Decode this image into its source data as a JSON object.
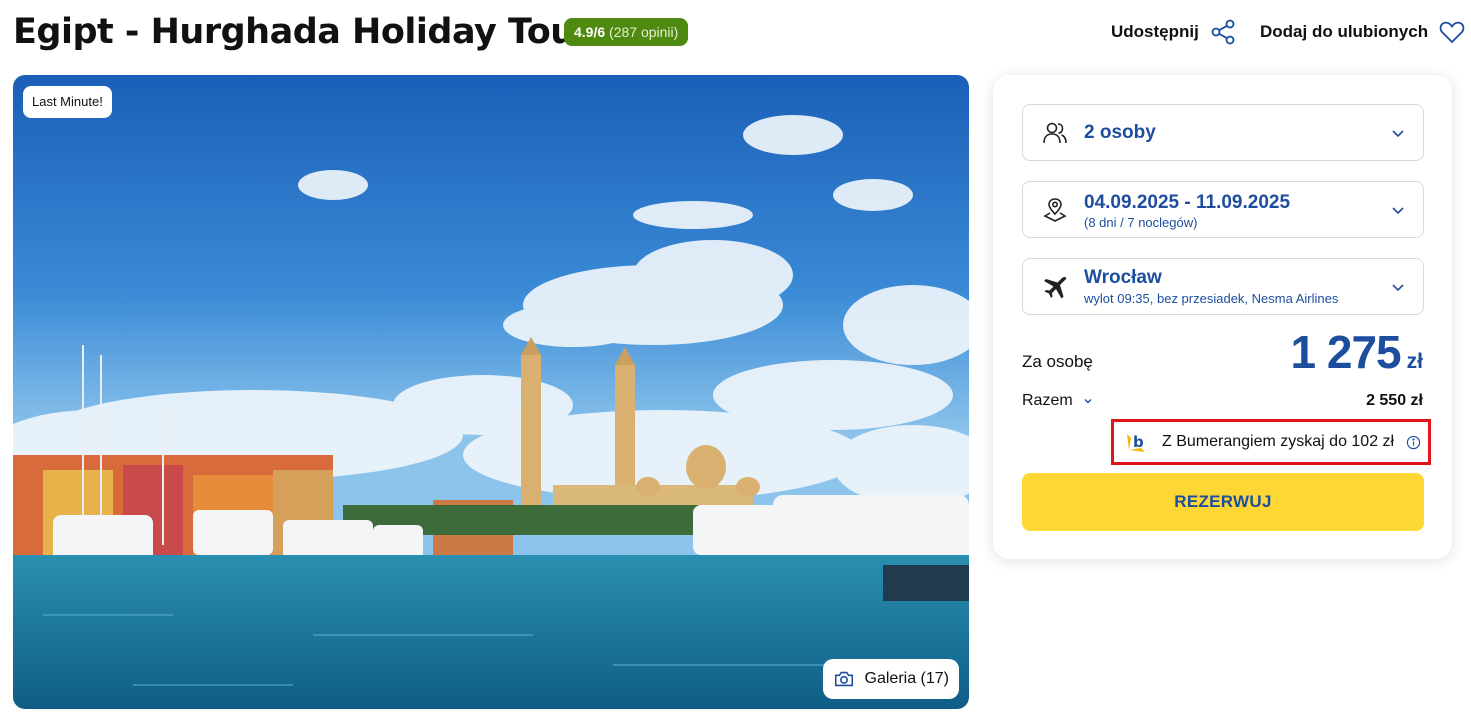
{
  "header": {
    "title": "Egipt - Hurghada Holiday Tour",
    "rating_score": "4.9/6",
    "rating_count": "(287 opinii)",
    "share_label": "Udostępnij",
    "favorite_label": "Dodaj do ulubionych"
  },
  "hero": {
    "badge": "Last Minute!",
    "gallery_label": "Galeria (17)"
  },
  "booking": {
    "travelers": "2 osoby",
    "dates": "04.09.2025 - 11.09.2025",
    "duration": "(8 dni / 7 noclegów)",
    "departure_city": "Wrocław",
    "flight_info": "wylot 09:35, bez przesiadek, Nesma Airlines",
    "per_person_label": "Za osobę",
    "price_value": "1 275",
    "price_currency": "zł",
    "total_label": "Razem",
    "total_value": "2 550 zł",
    "bumerang_text": "Z Bumerangiem zyskaj do 102 zł",
    "reserve_label": "REZERWUJ"
  },
  "colors": {
    "brand_blue": "#1d4e9e",
    "rating_green": "#4f8a10",
    "cta_yellow": "#fdd835",
    "highlight_red": "#e0161b"
  },
  "icons": [
    "share-icon",
    "heart-icon",
    "camera-icon",
    "users-icon",
    "location-pin-icon",
    "plane-icon",
    "chevron-down-icon",
    "bumerang-logo-icon",
    "info-icon"
  ]
}
